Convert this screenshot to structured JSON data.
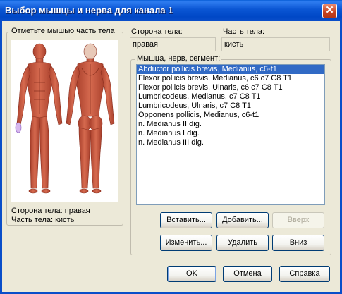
{
  "window": {
    "title": "Выбор мышцы и нерва для канала 1"
  },
  "body_group": {
    "legend": "Отметьте мышью часть тела",
    "side_status_label": "Сторона тела: правая",
    "part_status_label": "Часть тела: кисть"
  },
  "side_field": {
    "label": "Сторона тела:",
    "value": "правая"
  },
  "part_field": {
    "label": "Часть тела:",
    "value": "кисть"
  },
  "muscle_group": {
    "legend": "Мышца, нерв, сегмент:",
    "items": [
      "Abductor pollicis brevis, Medianus, c6-t1",
      "Flexor pollicis brevis, Medianus, c6 c7 C8 T1",
      "Flexor pollicis brevis, Ulnaris, c6 c7 C8 T1",
      "Lumbricodeus, Medianus, c7 C8 T1",
      "Lumbricodeus, Ulnaris, c7 C8 T1",
      "Opponens pollicis, Medianus, c6-t1",
      "n. Medianus II dig.",
      "n. Medianus I dig.",
      "n. Medianus III dig."
    ],
    "selected_index": 0
  },
  "buttons": {
    "insert": "Вставить...",
    "add": "Добавить...",
    "up": "Вверх",
    "edit": "Изменить...",
    "delete": "Удалить",
    "down": "Вниз",
    "ok": "OK",
    "cancel": "Отмена",
    "help": "Справка"
  },
  "colors": {
    "titlebar": "#0a55d3",
    "dialog_bg": "#ece9d8",
    "selection": "#316ac5",
    "muscle": "#c8573f"
  }
}
